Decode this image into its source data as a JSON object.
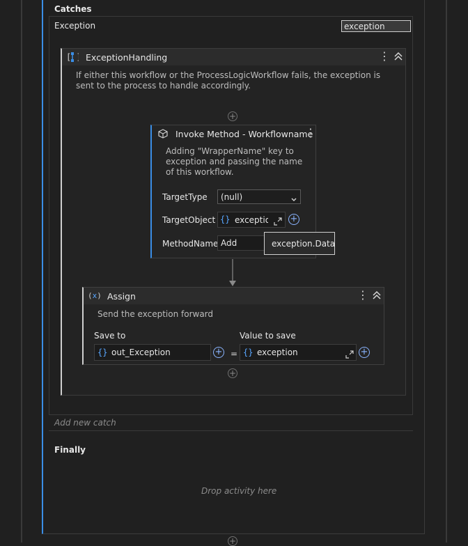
{
  "catches": {
    "header": "Catches",
    "exception_label": "Exception",
    "exception_type": "exception",
    "add_new_catch": "Add new catch"
  },
  "exception_handling": {
    "title": "ExceptionHandling",
    "description": "If either this workflow or the ProcessLogicWorkflow fails, the exception is sent to the process to handle accordingly."
  },
  "invoke_method": {
    "title": "Invoke Method - Workflowname",
    "description": "Adding \"WrapperName\" key  to exception and passing the name of this workflow.",
    "target_type_label": "TargetType",
    "target_type_value": "(null)",
    "target_object_label": "TargetObject",
    "target_object_value": "exception",
    "method_name_label": "MethodName",
    "method_name_value": "Add",
    "tooltip": "exception.Data"
  },
  "assign": {
    "title": "Assign",
    "description": "Send the exception forward",
    "save_to_label": "Save to",
    "save_to_value": "out_Exception",
    "equals": "=",
    "value_label": "Value to save",
    "value_value": "exception"
  },
  "finally": {
    "header": "Finally",
    "drop_text": "Drop activity here"
  },
  "icons": {
    "braces": "{}",
    "plus": "+",
    "more": "⋮",
    "collapse": "«",
    "expand": "⤢",
    "chevron": "⌄"
  },
  "colors": {
    "accent": "#3a8ee6",
    "background": "#202020",
    "panel": "#262626"
  }
}
